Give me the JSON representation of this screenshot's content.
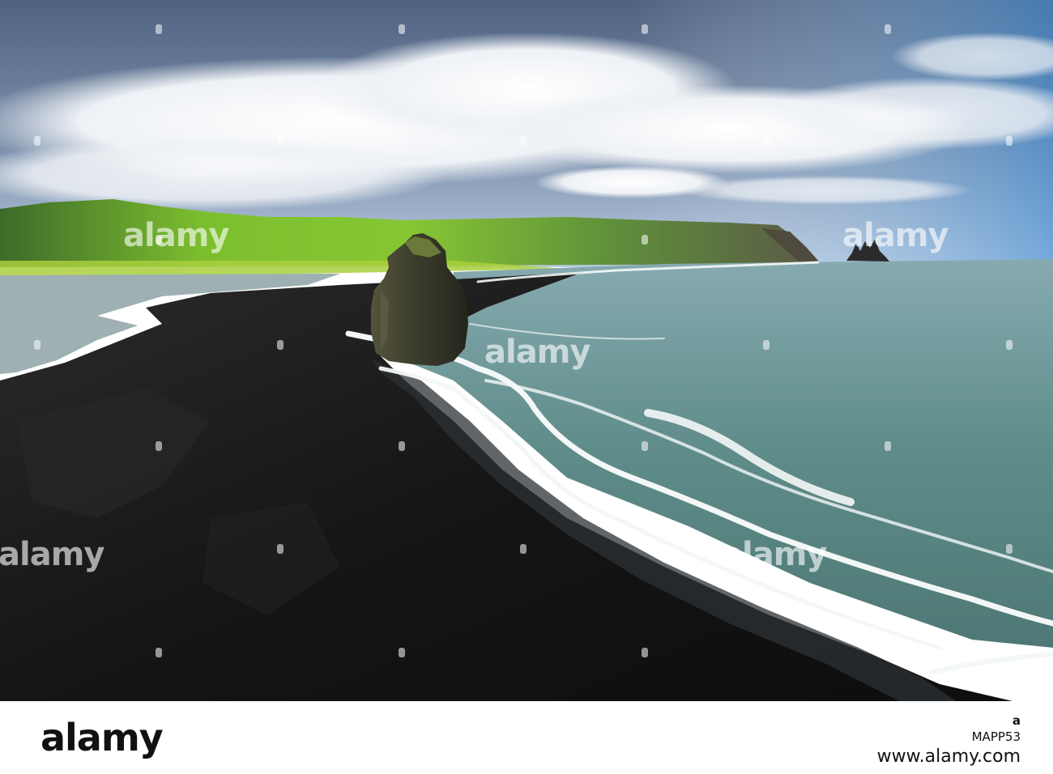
{
  "photo": {
    "description_colors": {
      "sky_top": "#5d6f8c",
      "cloud": "#eef0f3",
      "hills": "#6fae2e",
      "sea": "#5f8a86",
      "sand": "#141414",
      "rock": "#3a3a2e"
    }
  },
  "watermark": {
    "text": "alamy"
  },
  "footer": {
    "logo": "alamy",
    "stock_id_line1": "a",
    "stock_id_line2": "MAPP53",
    "url": "www.alamy.com"
  }
}
